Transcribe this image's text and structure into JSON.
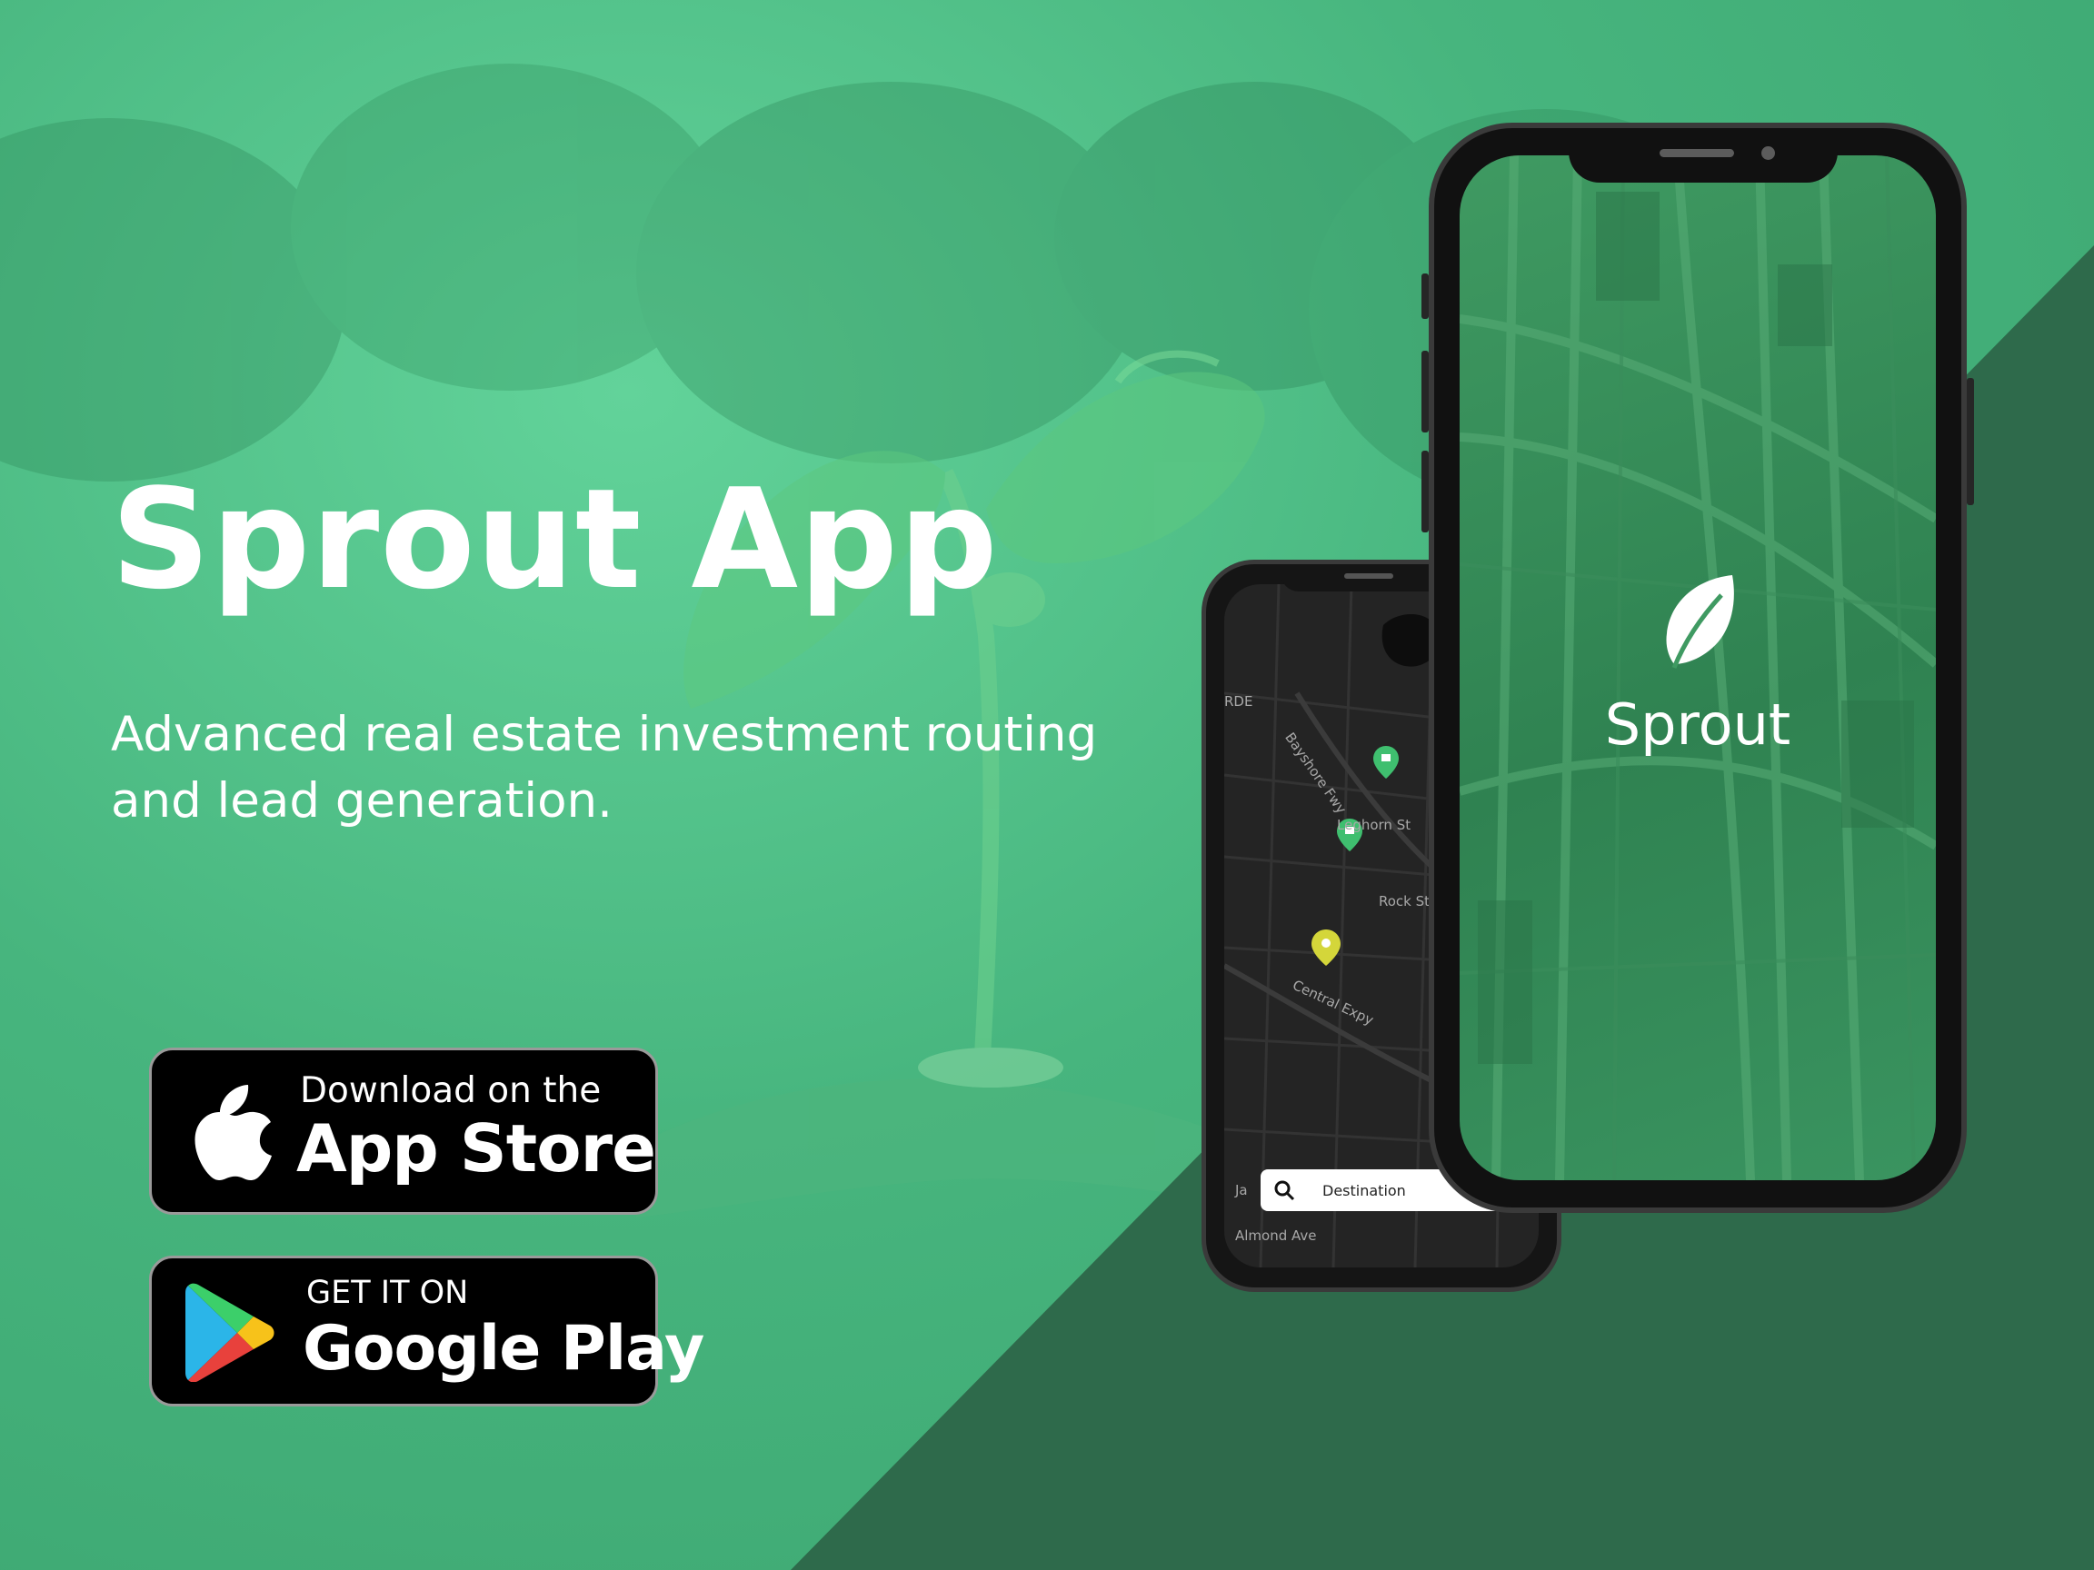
{
  "hero": {
    "title": "Sprout App",
    "subtitle": "Advanced real estate investment routing and lead generation."
  },
  "badges": {
    "app_store": {
      "top_line": "Download on the",
      "main": "App Store",
      "icon": "apple-icon"
    },
    "google_play": {
      "top_line": "GET IT ON",
      "main": "Google Play",
      "icon": "google-play-icon"
    }
  },
  "map_phone": {
    "streets": [
      "RDE",
      "Bayshore Fwy",
      "Leghorn St",
      "Rock St",
      "Central Expy",
      "Ja",
      "Almond Ave"
    ],
    "search": {
      "placeholder": "Destination",
      "icon": "search-icon"
    },
    "pins": [
      {
        "icon": "home-pin-icon",
        "color": "#3fbf6f"
      },
      {
        "icon": "home-pin-icon",
        "color": "#3fbf6f"
      },
      {
        "icon": "lightbulb-pin-icon",
        "color": "#d4d63a"
      }
    ]
  },
  "splash_phone": {
    "app_name": "Sprout",
    "logo": "leaf-icon"
  },
  "colors": {
    "accent_green": "#4cc184",
    "dark_green": "#2e6a4b",
    "badge_black": "#000000"
  }
}
